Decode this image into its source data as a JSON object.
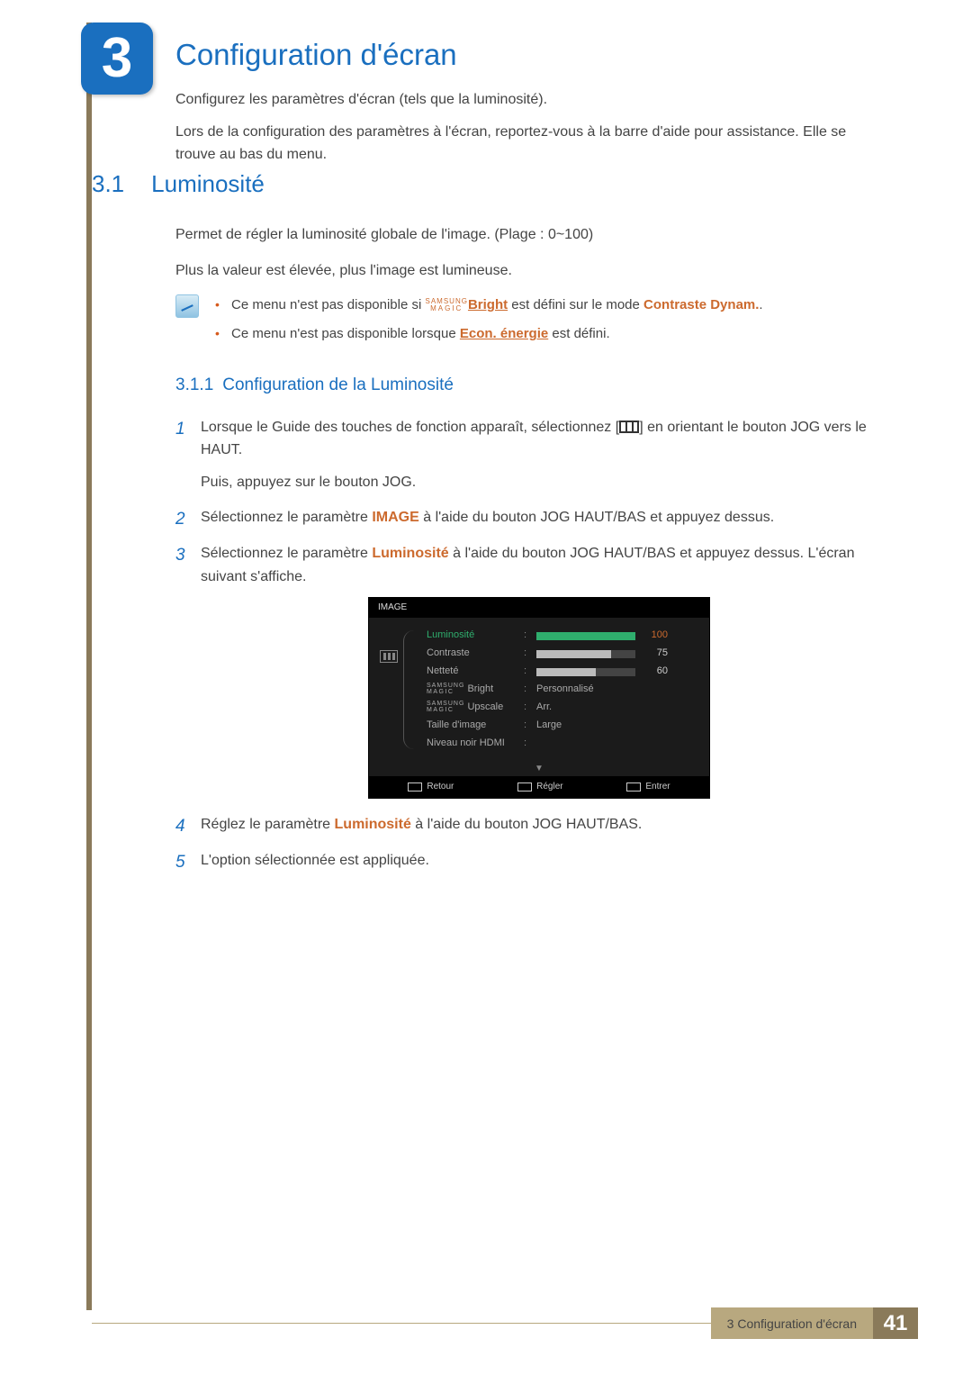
{
  "chapter": {
    "number": "3",
    "title": "Configuration d'écran"
  },
  "intro": {
    "p1": "Configurez les paramètres d'écran (tels que la luminosité).",
    "p2": "Lors de la configuration des paramètres à l'écran, reportez-vous à la barre d'aide pour assistance. Elle se trouve au bas du menu."
  },
  "section": {
    "number": "3.1",
    "title": "Luminosité"
  },
  "section_body": {
    "p1": "Permet de régler la luminosité globale de l'image. (Plage : 0~100)",
    "p2": "Plus la valeur est élevée, plus l'image est lumineuse."
  },
  "magic": {
    "top": "SAMSUNG",
    "bottom": "MAGIC"
  },
  "notes": {
    "n1_a": "Ce menu n'est pas disponible si ",
    "n1_link": "Bright",
    "n1_b": " est défini sur le mode ",
    "n1_kw": "Contraste Dynam.",
    "n1_c": ".",
    "n2_a": "Ce menu n'est pas disponible lorsque ",
    "n2_link": "Econ. énergie",
    "n2_b": " est défini."
  },
  "subsection": {
    "number": "3.1.1",
    "title": "Configuration de la Luminosité"
  },
  "steps": {
    "s1_a": "Lorsque le Guide des touches de fonction apparaît, sélectionnez [",
    "s1_b": "] en orientant le bouton JOG vers le HAUT.",
    "s1_c": "Puis, appuyez sur le bouton JOG.",
    "s2_a": "Sélectionnez le paramètre ",
    "s2_kw": "IMAGE",
    "s2_b": " à l'aide du bouton JOG HAUT/BAS et appuyez dessus.",
    "s3_a": "Sélectionnez le paramètre ",
    "s3_kw": "Luminosité",
    "s3_b": " à l'aide du bouton JOG HAUT/BAS et appuyez dessus. L'écran suivant s'affiche.",
    "s4_a": "Réglez le paramètre ",
    "s4_kw": "Luminosité",
    "s4_b": " à l'aide du bouton JOG HAUT/BAS.",
    "s5": "L'option sélectionnée est appliquée."
  },
  "osd": {
    "title": "IMAGE",
    "rows": [
      {
        "label": "Luminosité",
        "type": "bar",
        "fill": 100,
        "value": "100",
        "selected": true
      },
      {
        "label": "Contraste",
        "type": "bar",
        "fill": 75,
        "value": "75",
        "selected": false
      },
      {
        "label": "Netteté",
        "type": "bar",
        "fill": 60,
        "value": "60",
        "selected": false
      },
      {
        "label": "Bright",
        "type": "text",
        "value": "Personnalisé",
        "magic": true
      },
      {
        "label": "Upscale",
        "type": "text",
        "value": "Arr.",
        "magic": true
      },
      {
        "label": "Taille d'image",
        "type": "text",
        "value": "Large"
      },
      {
        "label": "Niveau noir HDMI",
        "type": "text",
        "value": ""
      }
    ],
    "footer": {
      "back": "Retour",
      "adjust": "Régler",
      "enter": "Entrer"
    }
  },
  "chart_data": {
    "type": "bar",
    "title": "IMAGE OSD sliders",
    "categories": [
      "Luminosité",
      "Contraste",
      "Netteté"
    ],
    "values": [
      100,
      75,
      60
    ],
    "xlabel": "",
    "ylabel": "",
    "ylim": [
      0,
      100
    ]
  },
  "footer": {
    "label": "3 Configuration d'écran",
    "page": "41"
  }
}
